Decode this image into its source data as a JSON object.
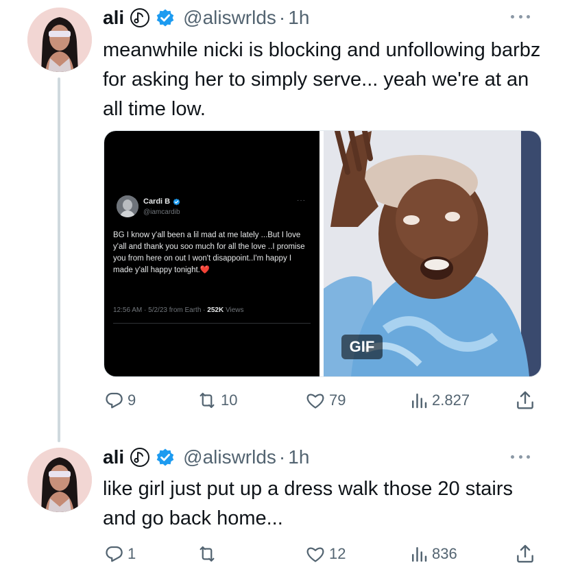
{
  "tweets": [
    {
      "name": "ali",
      "handle": "@aliswrlds",
      "dot": "·",
      "time": "1h",
      "text": "meanwhile nicki is blocking and unfollowing barbz for asking her to simply serve... yeah we're at an all time low.",
      "media": {
        "screenshot": {
          "name": "Cardi B",
          "handle": "@iamcardib",
          "more": "···",
          "text": "BG I know y'all been a lil mad at me lately ...But I love y'all and thank you soo much for all the love ..I promise you from here on out I won't disappoint..I'm happy I made y'all happy tonight.",
          "heart": "❤️",
          "meta": "12:56 AM · 5/2/23 from Earth · ",
          "views_count": "252K",
          "views_label": " Views"
        },
        "gif_label": "GIF"
      },
      "actions": {
        "replies": "9",
        "retweets": "10",
        "likes": "79",
        "views": "2.827"
      }
    },
    {
      "name": "ali",
      "handle": "@aliswrlds",
      "dot": "·",
      "time": "1h",
      "text": "like girl just put up a dress walk those 20 stairs and go back home...",
      "actions": {
        "replies": "1",
        "retweets": "",
        "likes": "12",
        "views": "836"
      }
    }
  ],
  "colors": {
    "verified": "#1d9bf0",
    "secondary_text": "#536471",
    "thread_line": "#cfd9de",
    "heart": "#f91880"
  },
  "icons": [
    "music-disc-emoji-icon",
    "verified-badge-icon",
    "more-icon",
    "reply-icon",
    "retweet-icon",
    "like-icon",
    "views-icon",
    "share-icon"
  ]
}
